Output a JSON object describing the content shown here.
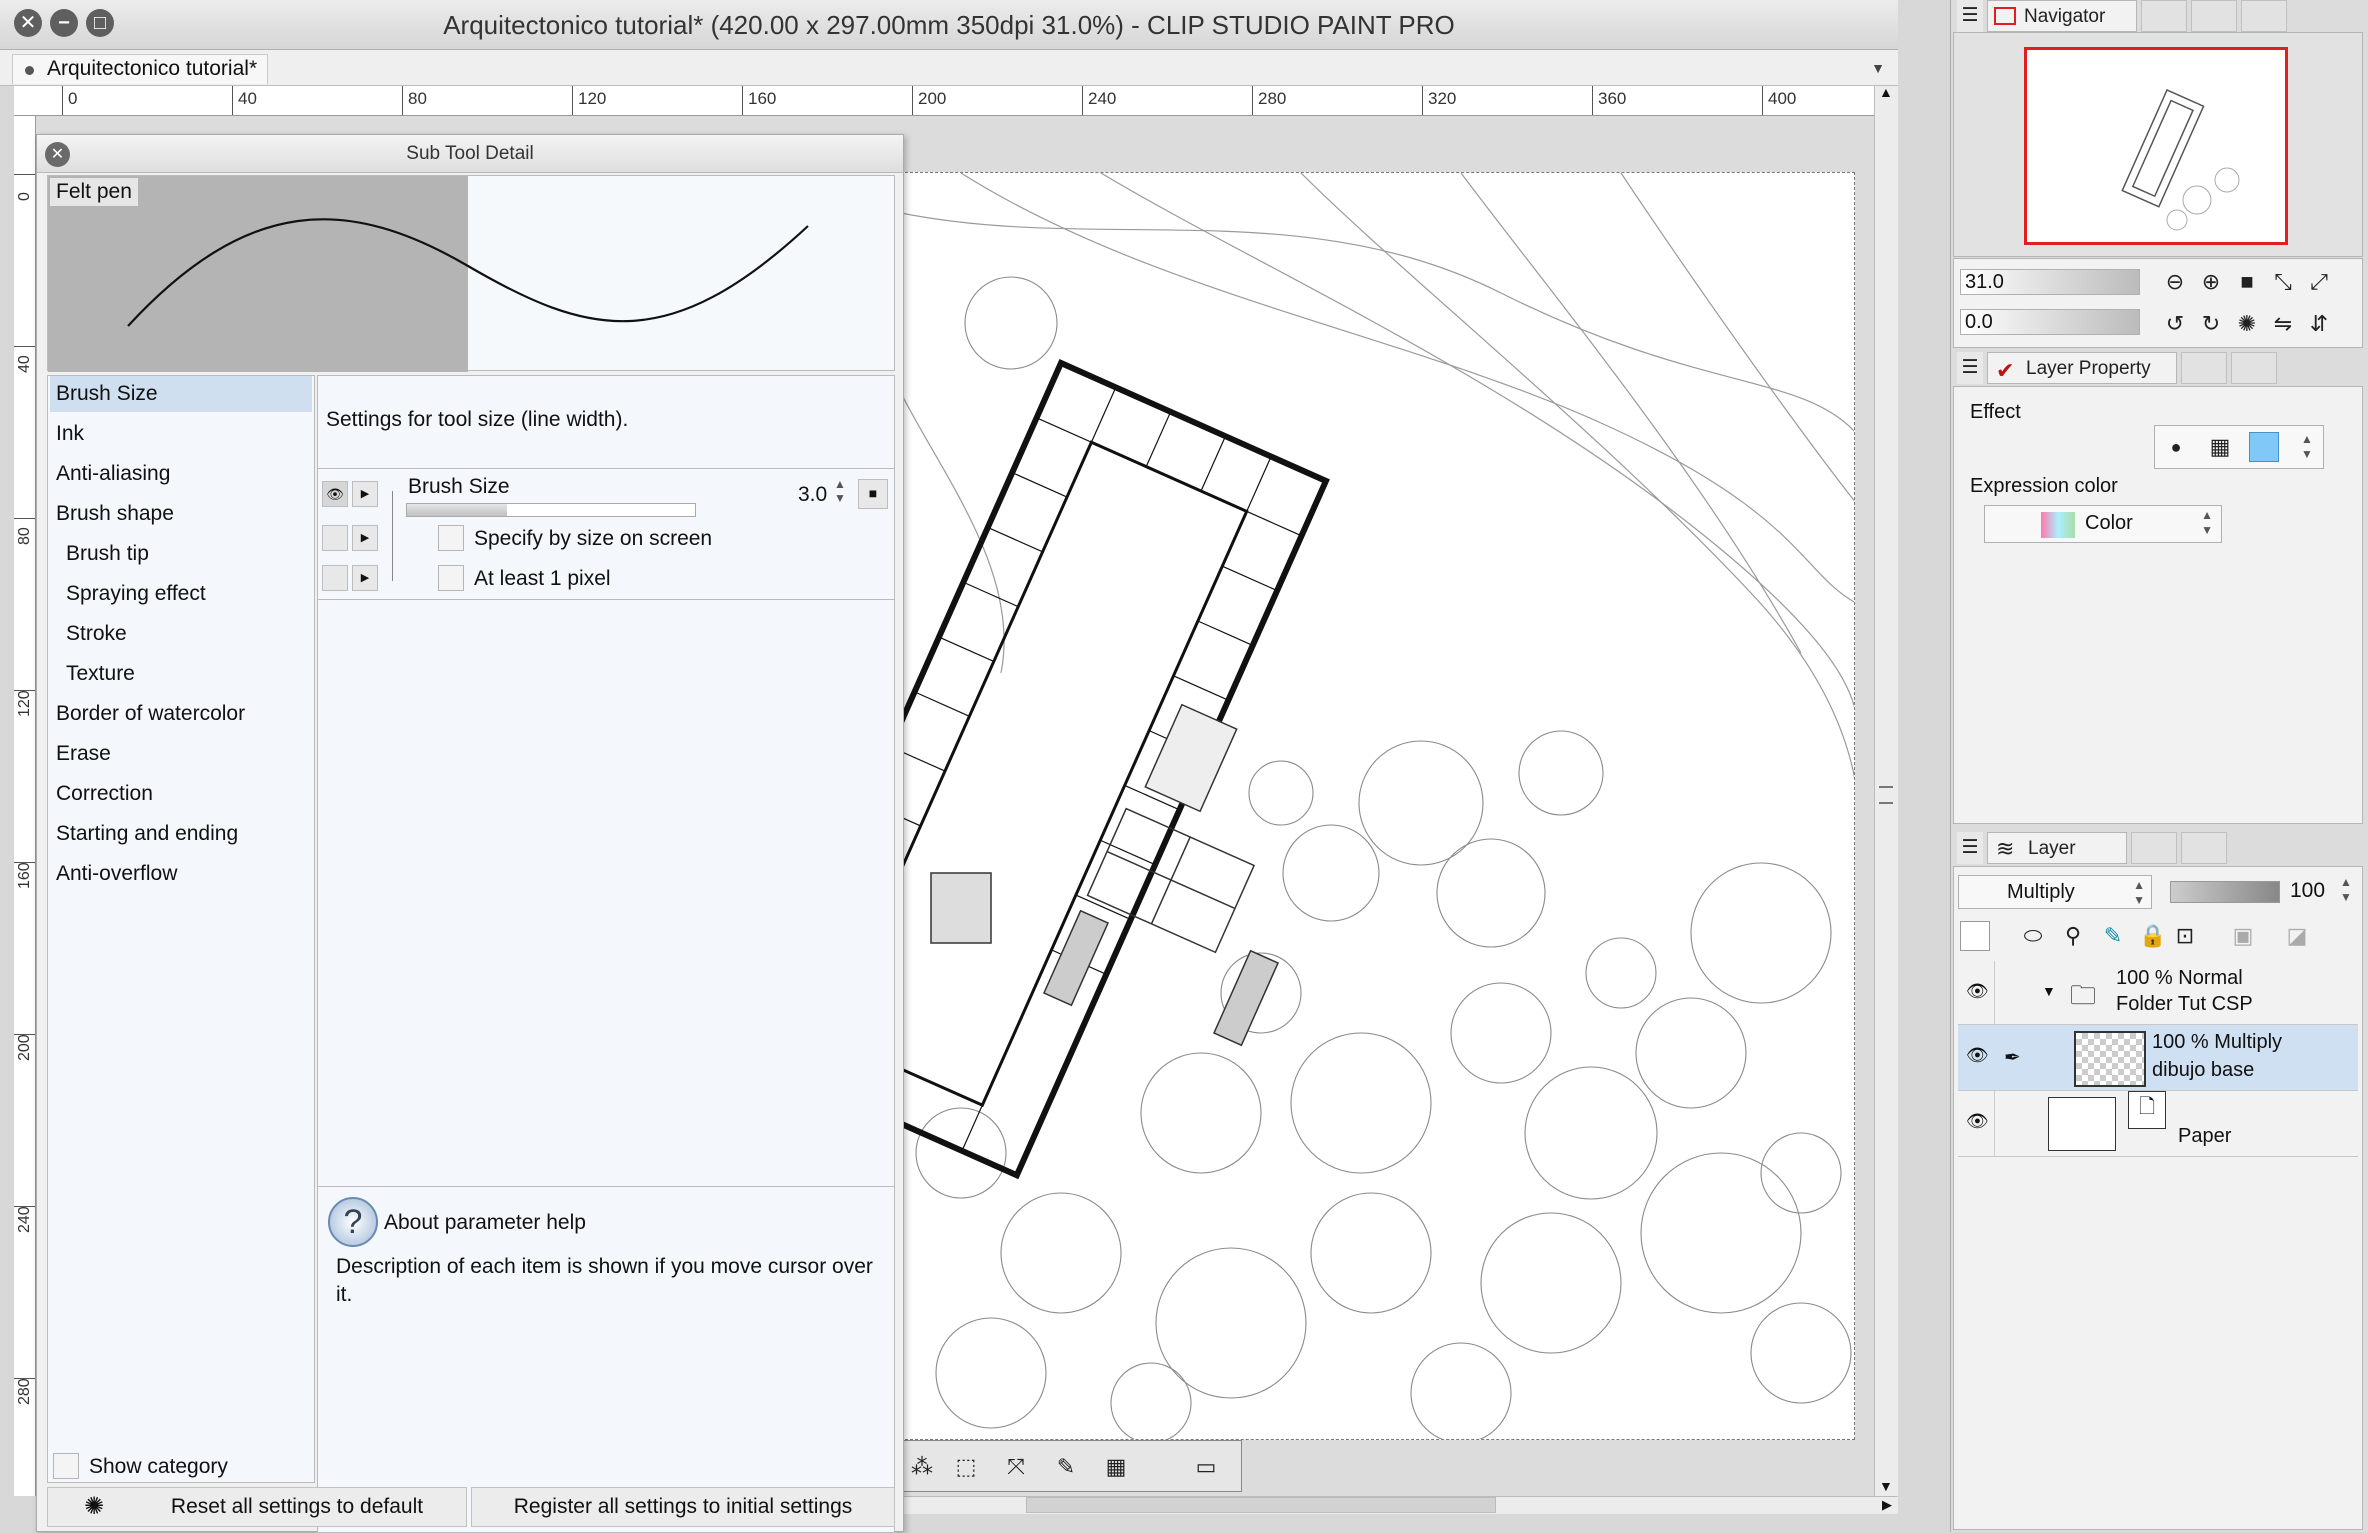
{
  "window": {
    "title": "Arquitectonico tutorial* (420.00 x 297.00mm 350dpi 31.0%)  - CLIP STUDIO PAINT PRO",
    "close_glyph": "✕",
    "minimize_glyph": "−",
    "zoom_glyph": "□"
  },
  "document_tab": {
    "label": "Arquitectonico tutorial*"
  },
  "ruler_top": [
    "0",
    "40",
    "80",
    "120",
    "160",
    "200",
    "240",
    "280",
    "320",
    "360",
    "400"
  ],
  "ruler_left": [
    "0",
    "40",
    "80",
    "120",
    "160",
    "200",
    "240",
    "280"
  ],
  "sub_tool_detail": {
    "title": "Sub Tool Detail",
    "preview_label": "Felt pen",
    "categories": [
      {
        "label": "Brush Size",
        "selected": true
      },
      {
        "label": "Ink"
      },
      {
        "label": "Anti-aliasing"
      },
      {
        "label": "Brush shape"
      },
      {
        "label": "Brush tip",
        "sub": true
      },
      {
        "label": "Spraying effect",
        "sub": true
      },
      {
        "label": "Stroke",
        "sub": true
      },
      {
        "label": "Texture",
        "sub": true
      },
      {
        "label": "Border of watercolor"
      },
      {
        "label": "Erase"
      },
      {
        "label": "Correction"
      },
      {
        "label": "Starting and ending"
      },
      {
        "label": "Anti-overflow"
      }
    ],
    "settings_description": "Settings for tool size (line width).",
    "brush_size": {
      "label": "Brush Size",
      "value": "3.0"
    },
    "specify_by_size": "Specify by size on screen",
    "at_least_1_pixel": "At least 1 pixel",
    "help_title": "About parameter help",
    "help_text": "Description of each item is shown if you move cursor over it.",
    "show_category": "Show category",
    "reset_button": "Reset all settings to default",
    "register_button": "Register all settings to initial settings"
  },
  "navigator": {
    "tab_label": "Navigator",
    "zoom_value": "31.0",
    "rotation_value": "0.0"
  },
  "layer_property": {
    "tab_label": "Layer Property",
    "effect_label": "Effect",
    "expression_color_label": "Expression color",
    "expression_color_value": "Color"
  },
  "layer_panel": {
    "tab_label": "Layer",
    "blend_mode": "Multiply",
    "opacity": "100",
    "layers": [
      {
        "line1": "100 % Normal",
        "line2": "Folder Tut CSP"
      },
      {
        "line1": "100 % Multiply",
        "line2": "dibujo base"
      },
      {
        "line1": "",
        "line2": "Paper"
      }
    ]
  },
  "colors": {
    "accent_selection": "#cfdff0",
    "navigator_frame": "#e02020"
  }
}
